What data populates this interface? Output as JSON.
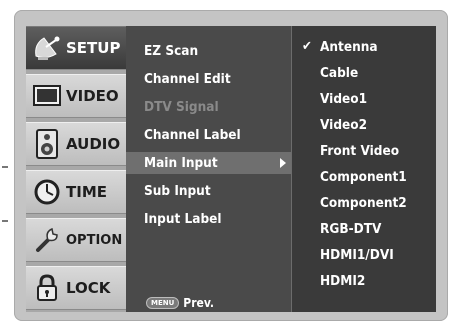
{
  "tabs": [
    {
      "label": "SETUP",
      "icon": "satellite-dish-icon",
      "active": true
    },
    {
      "label": "VIDEO",
      "icon": "tv-screen-icon",
      "active": false
    },
    {
      "label": "AUDIO",
      "icon": "speaker-icon",
      "active": false
    },
    {
      "label": "TIME",
      "icon": "clock-icon",
      "active": false
    },
    {
      "label": "OPTION",
      "icon": "wrench-icon",
      "active": false
    },
    {
      "label": "LOCK",
      "icon": "padlock-icon",
      "active": false
    }
  ],
  "setup_menu": [
    {
      "label": "EZ Scan",
      "enabled": true
    },
    {
      "label": "Channel Edit",
      "enabled": true
    },
    {
      "label": "DTV Signal",
      "enabled": false
    },
    {
      "label": "Channel Label",
      "enabled": true
    },
    {
      "label": "Main Input",
      "enabled": true,
      "selected": true
    },
    {
      "label": "Sub Input",
      "enabled": true
    },
    {
      "label": "Input Label",
      "enabled": true
    }
  ],
  "footer": {
    "menu_key": "MENU",
    "prev_label": "Prev."
  },
  "main_input_options": {
    "selected": "Antenna",
    "items": [
      "Antenna",
      "Cable",
      "Video1",
      "Video2",
      "Front Video",
      "Component1",
      "Component2",
      "RGB-DTV",
      "HDMI1/DVI",
      "HDMI2"
    ]
  },
  "colors": {
    "panel": "#4a4a4a",
    "list": "#3a3a3a",
    "active_tab": "#3a3a3a",
    "highlight": "#6f6f6f",
    "disabled": "#8a8a8a"
  }
}
